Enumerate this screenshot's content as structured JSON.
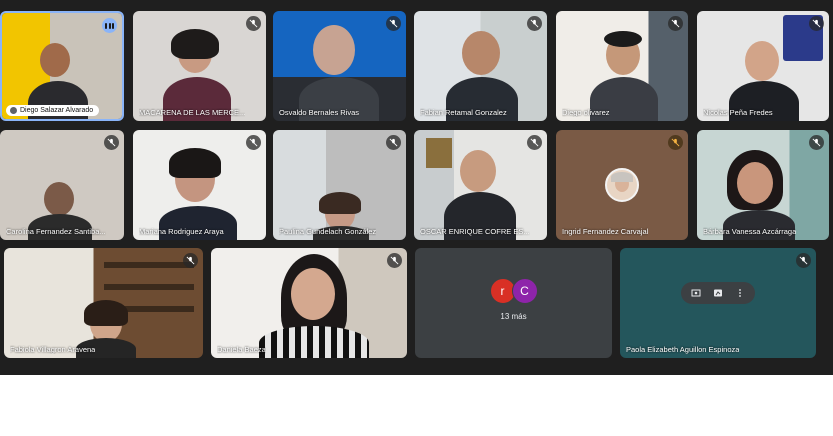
{
  "participants": [
    {
      "name": "Diego Salazar Alvarado"
    },
    {
      "name": "MACARENA DE LAS MERCE..."
    },
    {
      "name": "Osvaldo Bernales Rivas"
    },
    {
      "name": "Fabian Retamal Gonzalez"
    },
    {
      "name": "Diego olivarez"
    },
    {
      "name": "Nicolas Peña Fredes"
    },
    {
      "name": "Carolina Fernandez Santiba..."
    },
    {
      "name": "Mariana Rodriguez Araya"
    },
    {
      "name": "Paulina Gundelach González"
    },
    {
      "name": "OSCAR ENRIQUE COFRE ES..."
    },
    {
      "name": "Ingrid Fernandez Carvajal"
    },
    {
      "name": "Bárbara Vanessa Azcárraga"
    },
    {
      "name": "Fabiola Villagron Aravena"
    },
    {
      "name": "Daniela Baeza"
    },
    {
      "name": "Paola Elizabeth Aguillon Espinoza"
    }
  ],
  "overflow": {
    "avatars": [
      "r",
      "C"
    ],
    "label": "13 más",
    "colors": [
      "#d93025",
      "#8e24aa"
    ]
  },
  "icons": {
    "muted": "mic-off-icon",
    "speaking": "audio-level-icon",
    "pin": "pin-icon",
    "effects": "effects-icon",
    "more": "more-vert-icon"
  }
}
